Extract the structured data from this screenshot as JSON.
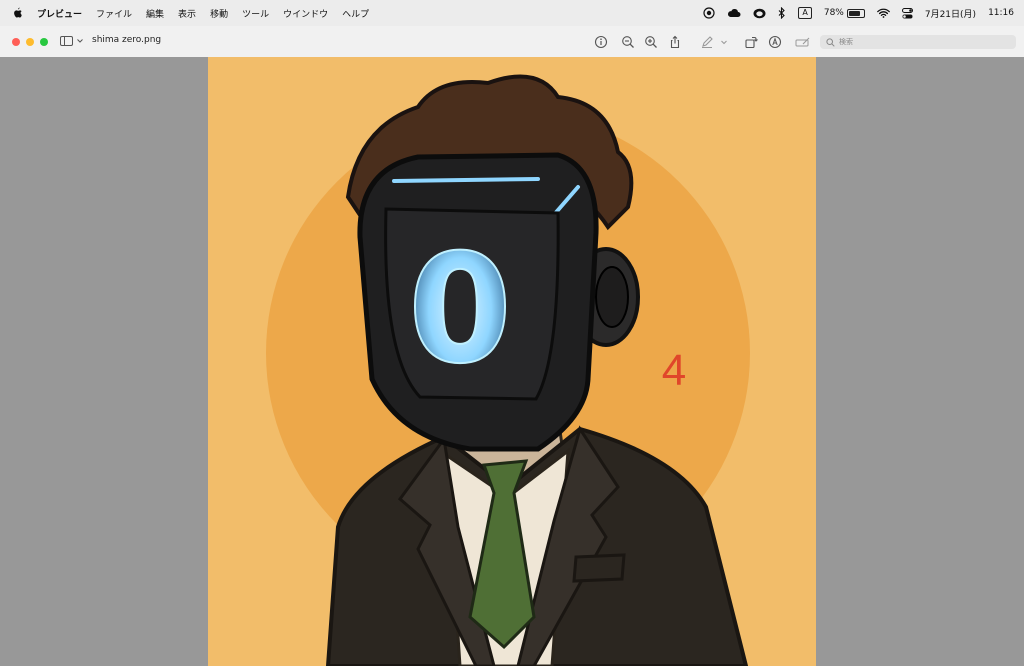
{
  "menubar": {
    "app_name": "プレビュー",
    "items": [
      "ファイル",
      "編集",
      "表示",
      "移動",
      "ツール",
      "ウインドウ",
      "ヘルプ"
    ],
    "status": {
      "input_mode": "A",
      "battery_percent": "78%",
      "battery_level": 0.78,
      "date": "7月21日(月)",
      "time": "11:16"
    }
  },
  "window": {
    "title": "shima zero.png",
    "search_placeholder": "検索"
  },
  "artwork": {
    "visor_glyph": "0",
    "side_number": "4",
    "colors": {
      "background": "#f2bd6a",
      "circle": "#eda84a",
      "visor_glow": "#8fd6ff",
      "number": "#e0462a",
      "tie": "#4f6f35",
      "suit": "#2b2620",
      "hair": "#4a2e1c"
    }
  }
}
